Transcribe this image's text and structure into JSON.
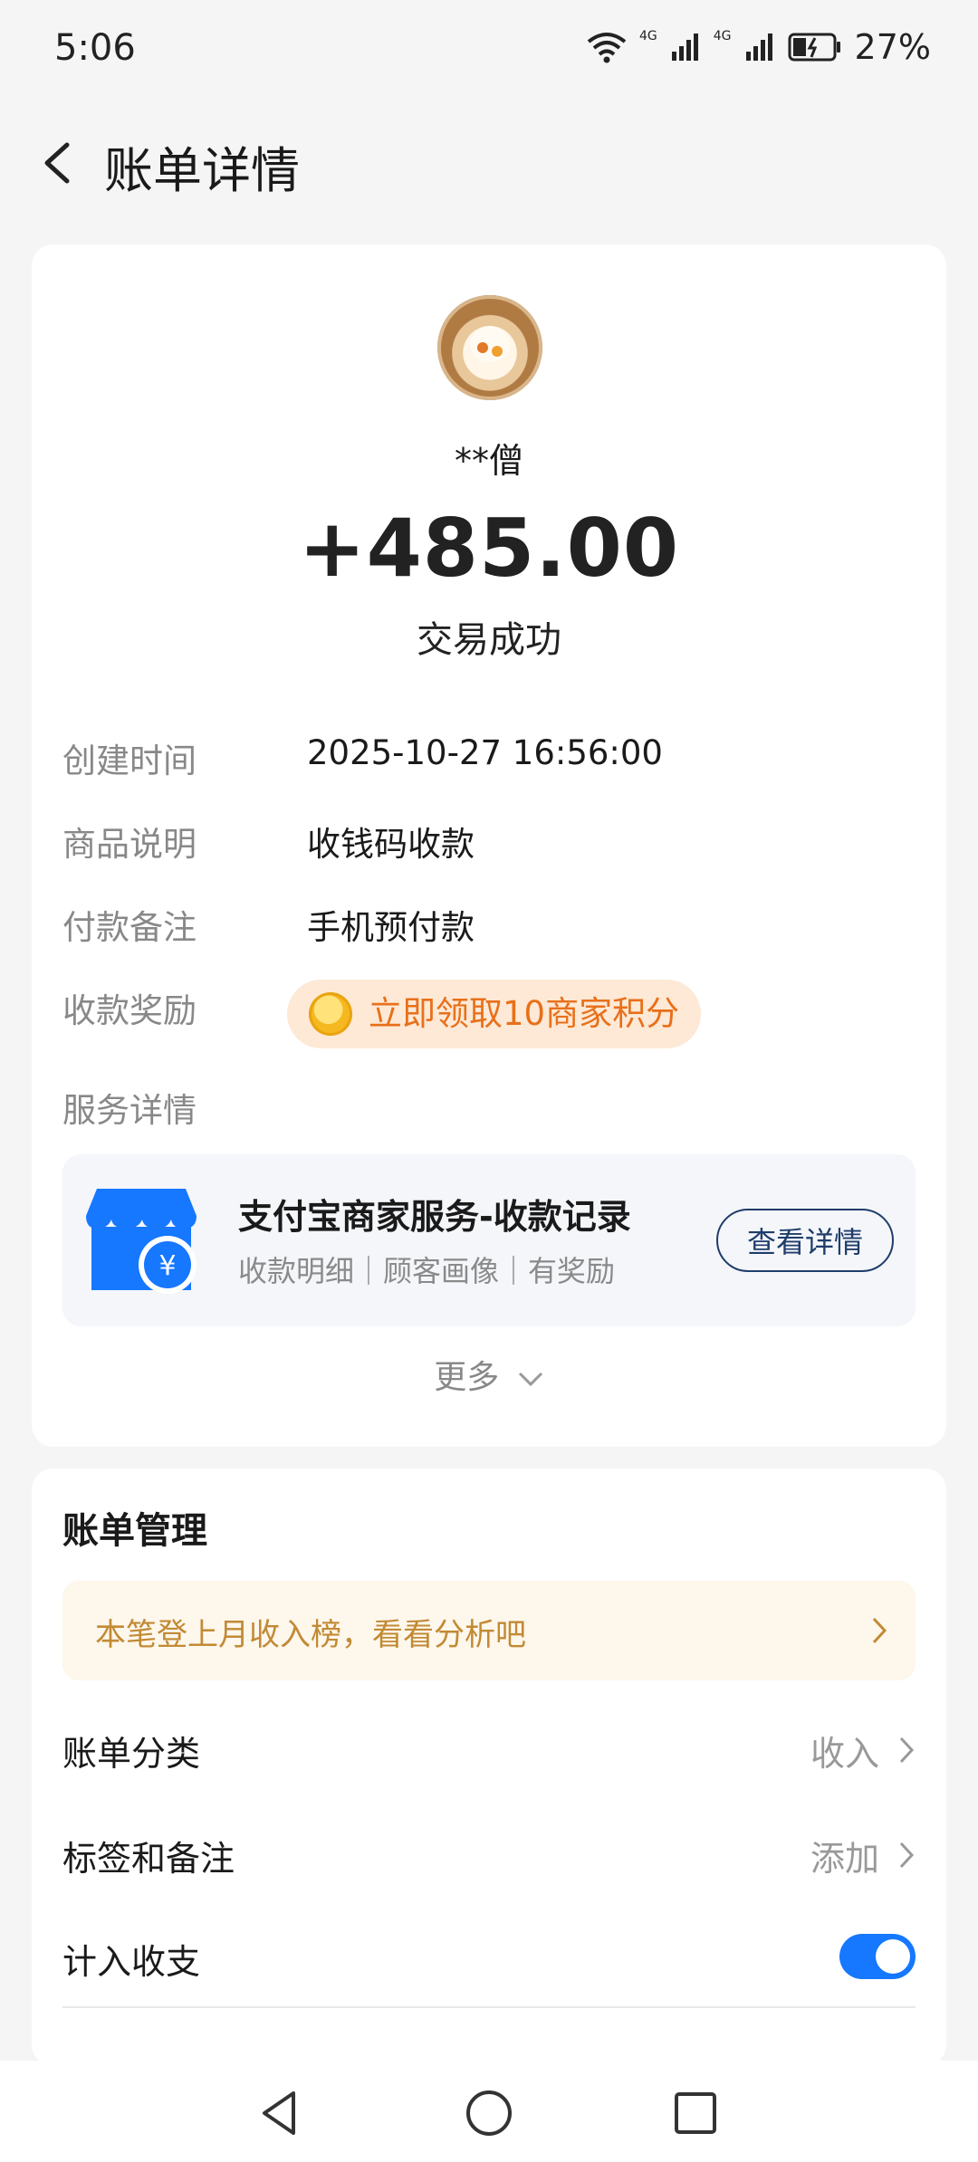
{
  "status_bar": {
    "time": "5:06",
    "network_1": "4G",
    "network_2": "4G",
    "battery": "27%"
  },
  "header": {
    "title": "账单详情"
  },
  "transaction": {
    "payer": "**僧",
    "amount": "+485.00",
    "status": "交易成功"
  },
  "details": [
    {
      "label": "创建时间",
      "value": "2025-10-27 16:56:00"
    },
    {
      "label": "商品说明",
      "value": "收钱码收款"
    },
    {
      "label": "付款备注",
      "value": "手机预付款"
    }
  ],
  "reward": {
    "label": "收款奖励",
    "text": "立即领取10商家积分"
  },
  "service": {
    "label": "服务详情",
    "title": "支付宝商家服务-收款记录",
    "subtitle": "收款明细｜顾客画像｜有奖励",
    "button": "查看详情",
    "icon": "shop-icon"
  },
  "more": "更多",
  "management": {
    "title": "账单管理",
    "banner": "本笔登上月收入榜，看看分析吧",
    "category_label": "账单分类",
    "category_value": "收入",
    "tags_label": "标签和备注",
    "tags_value": "添加",
    "include_label": "计入收支",
    "include_on": true
  },
  "colors": {
    "accent_blue": "#1677ff",
    "reward_orange": "#e8701a",
    "banner_gold": "#c28a34",
    "navy": "#1f3d6a"
  }
}
